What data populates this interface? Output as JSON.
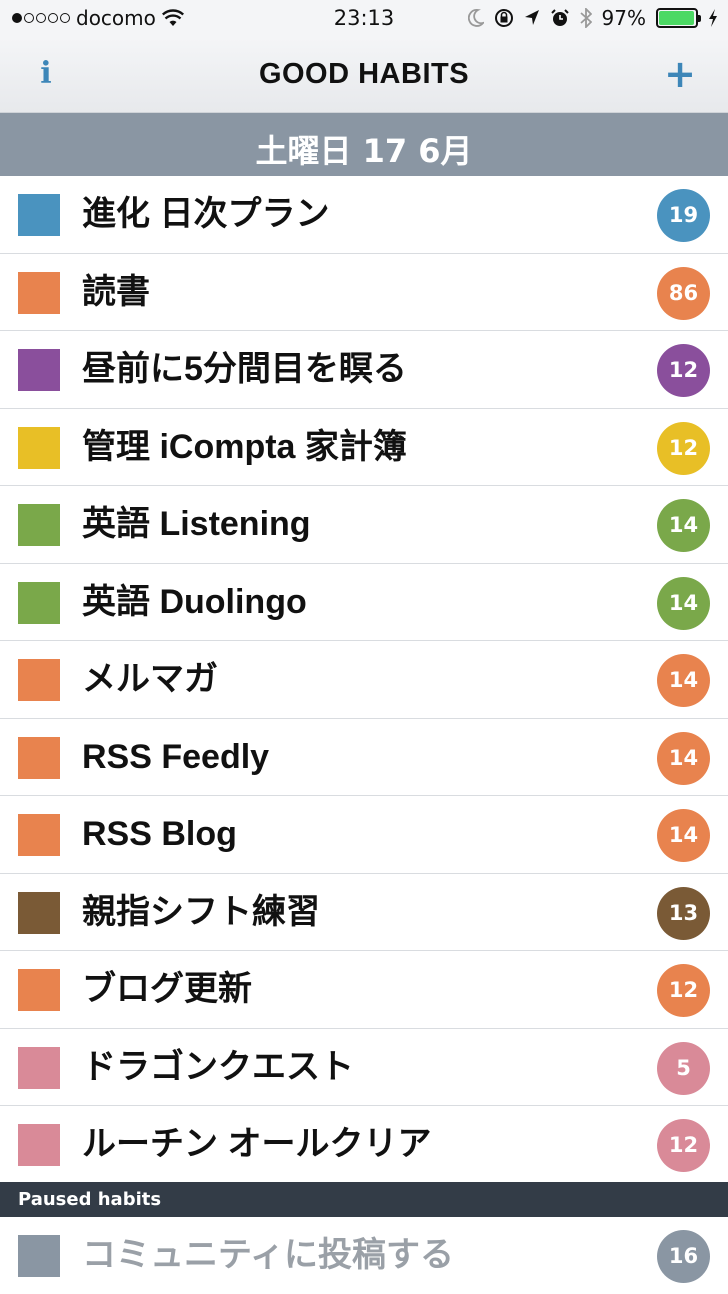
{
  "status_bar": {
    "carrier": "docomo",
    "time": "23:13",
    "battery_percent": "97%",
    "battery_level": 0.97,
    "icons": [
      "wifi-icon",
      "moon-icon",
      "rotation-lock-icon",
      "location-icon",
      "alarm-icon",
      "bluetooth-icon",
      "charging-icon"
    ]
  },
  "nav": {
    "info_label": "i",
    "title": "GOOD HABITS",
    "add_label": "+"
  },
  "date_header": "土曜日 17 6月",
  "habits": [
    {
      "name": "進化 日次プラン",
      "count": "19",
      "color": "#4a93bf"
    },
    {
      "name": "読書",
      "count": "86",
      "color": "#e8834e"
    },
    {
      "name": "昼前に5分間目を瞑る",
      "count": "12",
      "color": "#8a4f9c"
    },
    {
      "name": "管理 iCompta 家計簿",
      "count": "12",
      "color": "#e8bf26"
    },
    {
      "name": "英語 Listening",
      "count": "14",
      "color": "#7aa84a"
    },
    {
      "name": "英語 Duolingo",
      "count": "14",
      "color": "#7aa84a"
    },
    {
      "name": "メルマガ",
      "count": "14",
      "color": "#e8834e"
    },
    {
      "name": "RSS Feedly",
      "count": "14",
      "color": "#e8834e"
    },
    {
      "name": "RSS Blog",
      "count": "14",
      "color": "#e8834e"
    },
    {
      "name": "親指シフト練習",
      "count": "13",
      "color": "#7a5a36"
    },
    {
      "name": "ブログ更新",
      "count": "12",
      "color": "#e8834e"
    },
    {
      "name": "ドラゴンクエスト",
      "count": "5",
      "color": "#d98a98"
    },
    {
      "name": "ルーチン オールクリア",
      "count": "12",
      "color": "#d98a98"
    }
  ],
  "paused": {
    "header": "Paused habits",
    "items": [
      {
        "name": "コミュニティに投稿する",
        "count": "16",
        "color": "#8a96a3"
      }
    ]
  }
}
